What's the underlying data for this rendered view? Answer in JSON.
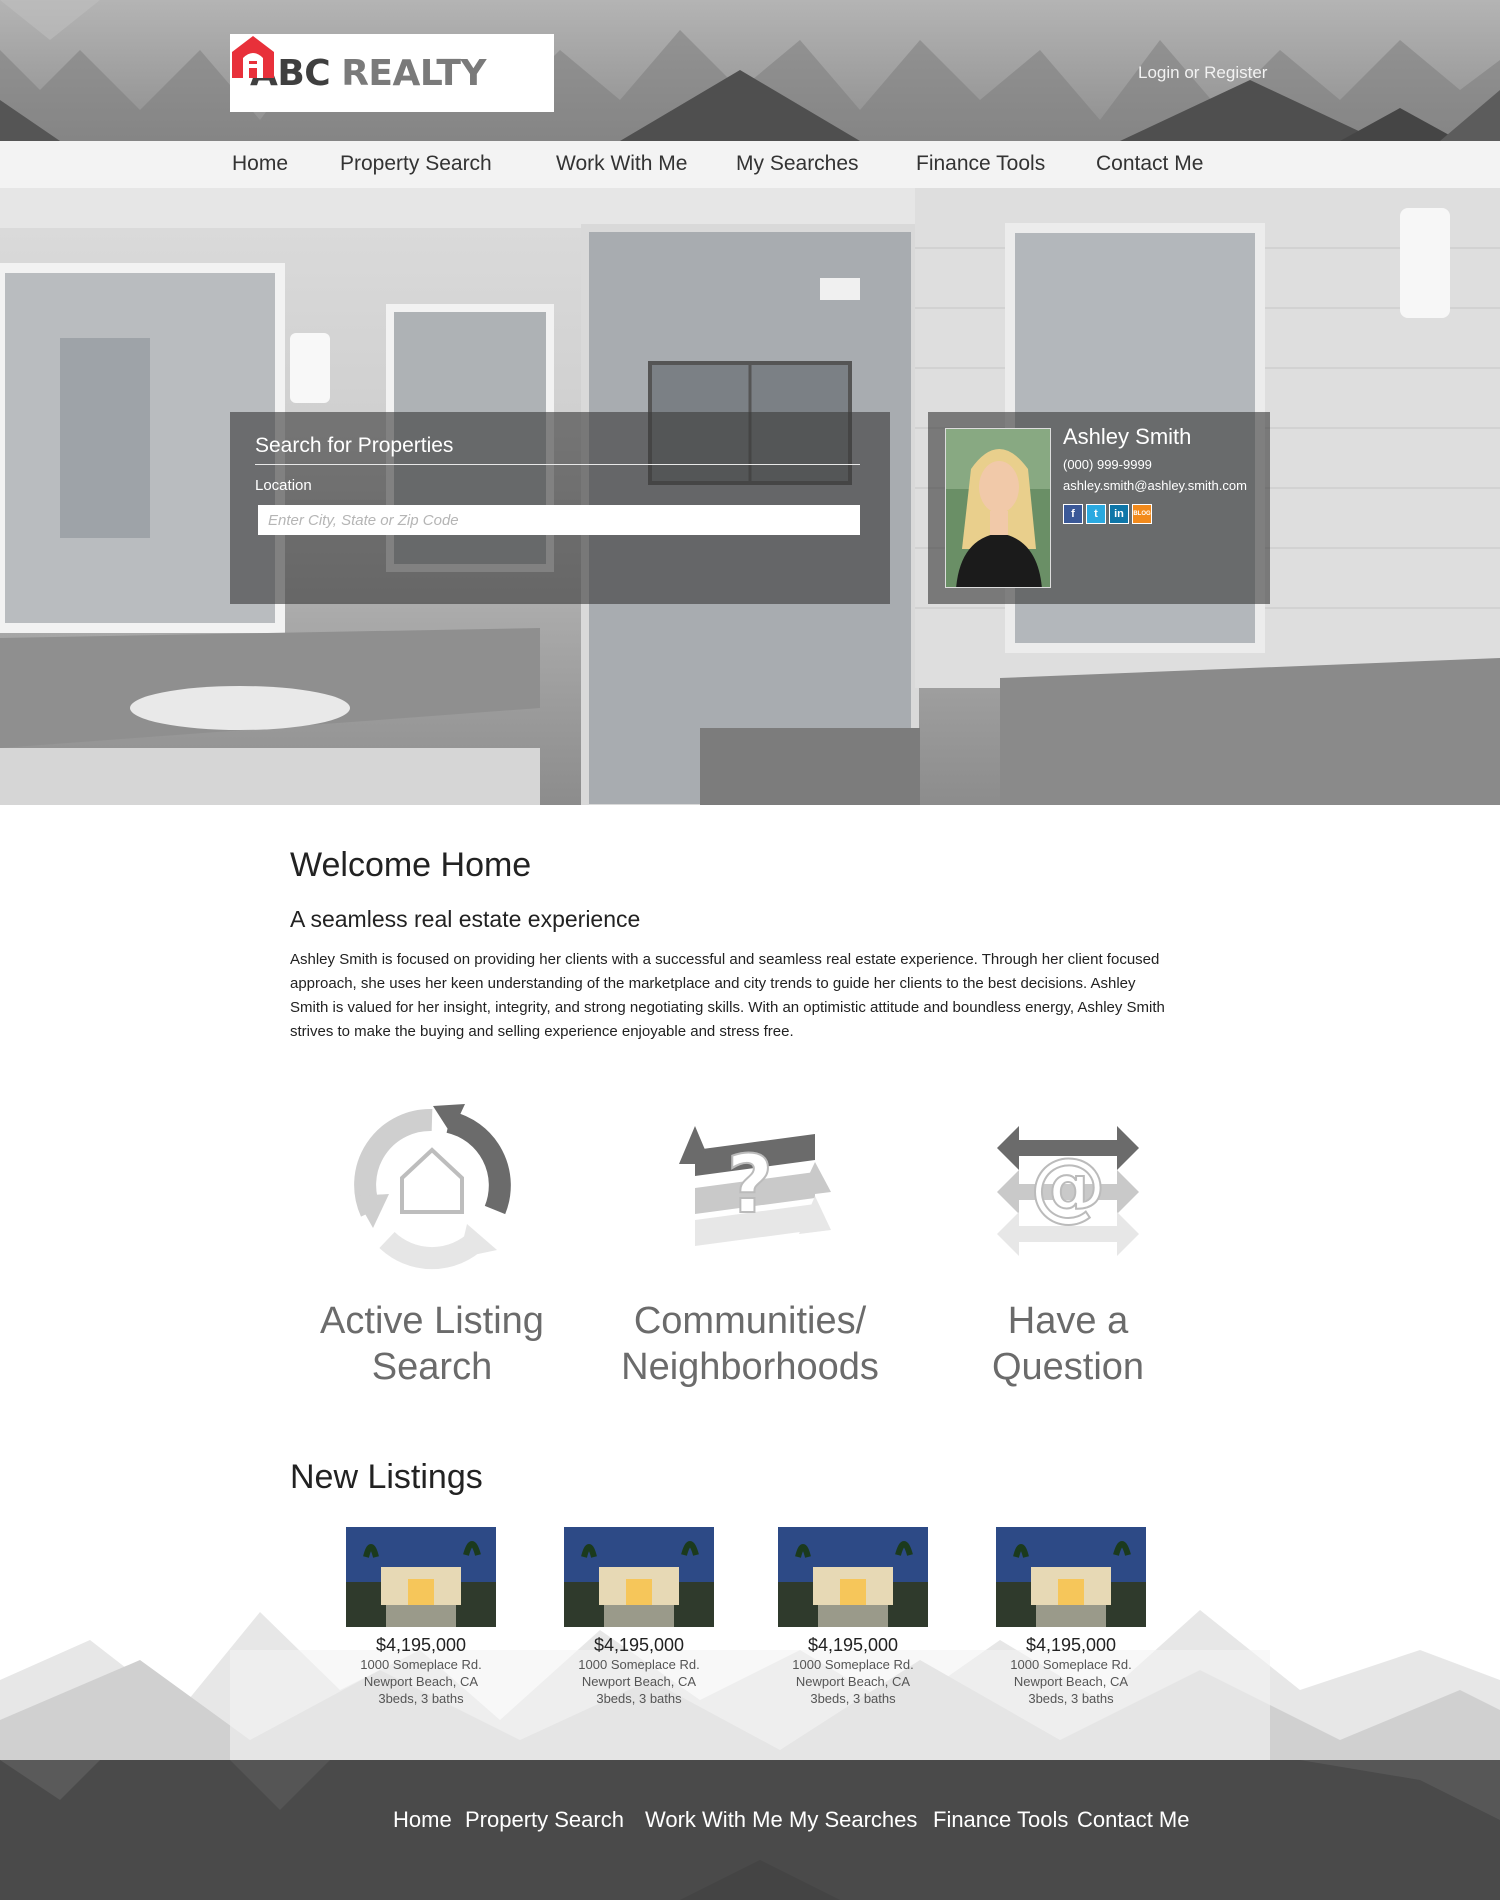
{
  "brand": {
    "name_bold": "ABC",
    "name_rest": "REALTY",
    "logo_letter": "A",
    "accent": "#e8303a"
  },
  "header": {
    "login": "Login or Register"
  },
  "nav": [
    "Home",
    "Property Search",
    "Work With Me",
    "My Searches",
    "Finance Tools",
    "Contact Me"
  ],
  "search": {
    "title": "Search for Properties",
    "location_label": "Location",
    "location_placeholder": "Enter City, State or Zip Code"
  },
  "agent": {
    "name": "Ashley Smith",
    "phone": "(000) 999-9999",
    "email": "ashley.smith@ashley.smith.com",
    "social": [
      {
        "icon": "facebook-icon",
        "glyph": "f",
        "color": "#3b5998"
      },
      {
        "icon": "twitter-icon",
        "glyph": "t",
        "color": "#2aa9e0"
      },
      {
        "icon": "linkedin-icon",
        "glyph": "in",
        "color": "#0e76a8"
      },
      {
        "icon": "blog-icon",
        "glyph": "BLOG",
        "color": "#f28a1c"
      }
    ]
  },
  "welcome": {
    "title": "Welcome Home",
    "subtitle": "A seamless real estate experience",
    "body": "Ashley Smith is focused on providing her clients with a successful and seamless real estate experience. Through her client focused approach, she uses her keen understanding of the marketplace and city trends to guide her clients to the best decisions. Ashley Smith is valued for her insight, integrity, and strong negotiating skills. With an optimistic attitude and boundless energy, Ashley Smith strives to make the buying and selling experience enjoyable and stress free."
  },
  "features": [
    {
      "line1": "Active Listing",
      "line2": "Search"
    },
    {
      "line1": "Communities/",
      "line2": "Neighborhoods"
    },
    {
      "line1": "Have a",
      "line2": "Question"
    }
  ],
  "listings": {
    "title": "New Listings",
    "items": [
      {
        "price": "$4,195,000",
        "address": "1000 Someplace Rd.",
        "city": "Newport Beach, CA",
        "details": "3beds, 3 baths"
      },
      {
        "price": "$4,195,000",
        "address": "1000 Someplace Rd.",
        "city": "Newport Beach, CA",
        "details": "3beds, 3 baths"
      },
      {
        "price": "$4,195,000",
        "address": "1000 Someplace Rd.",
        "city": "Newport Beach, CA",
        "details": "3beds, 3 baths"
      },
      {
        "price": "$4,195,000",
        "address": "1000 Someplace Rd.",
        "city": "Newport Beach, CA",
        "details": "3beds, 3 baths"
      }
    ]
  },
  "footer_nav": [
    "Home",
    "Property Search",
    "Work With Me",
    "My Searches",
    "Finance Tools",
    "Contact Me"
  ]
}
